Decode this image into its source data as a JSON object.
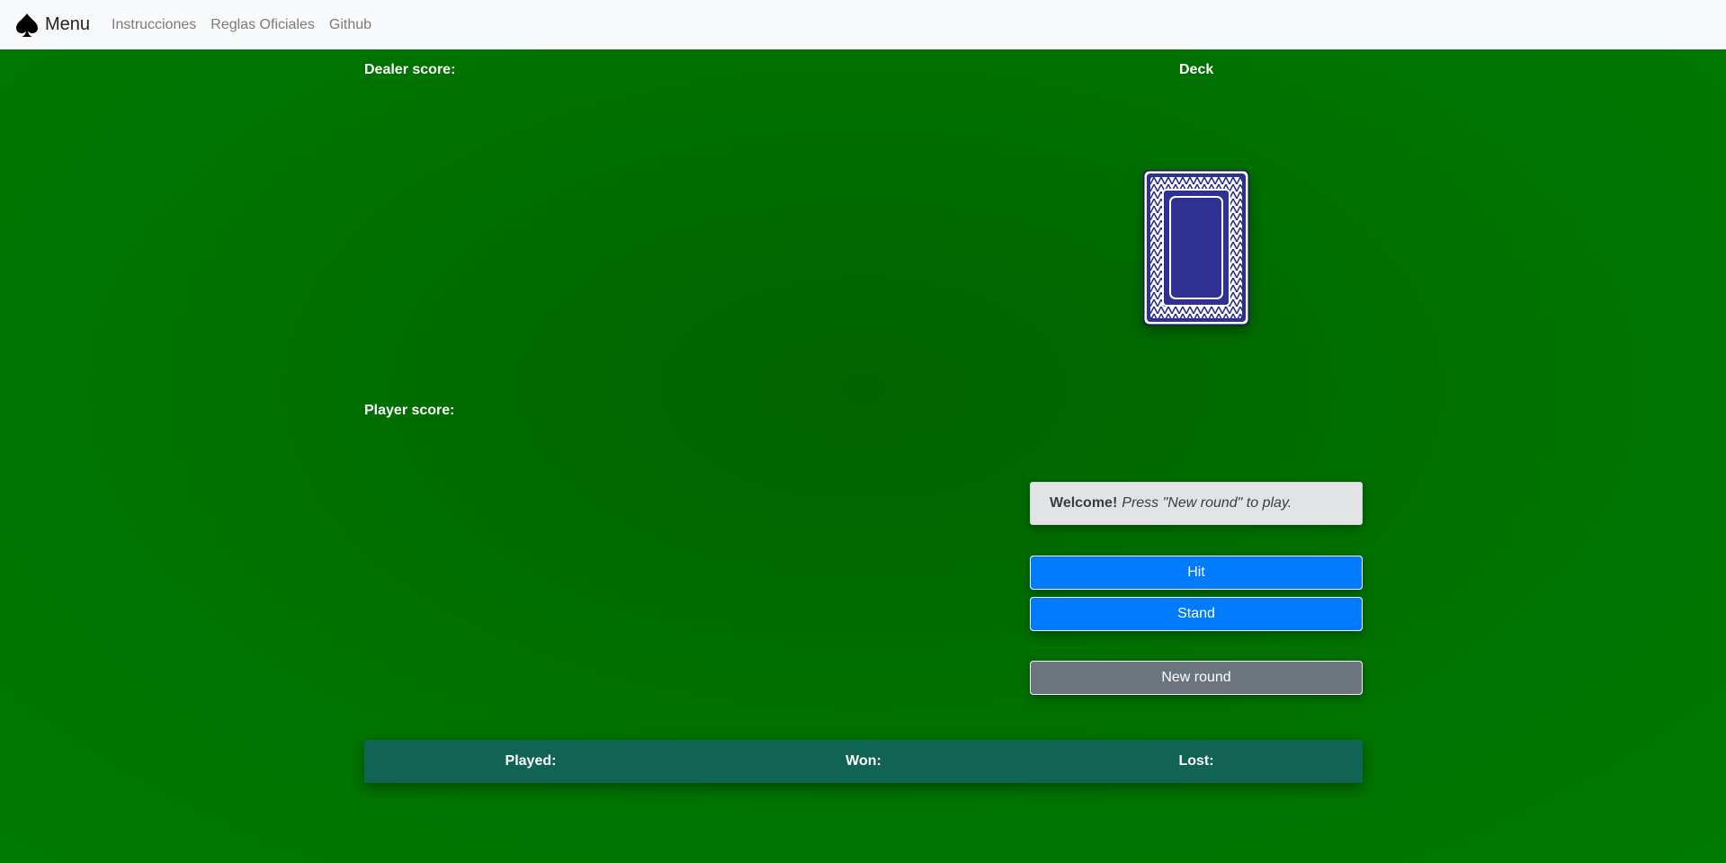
{
  "nav": {
    "brand": "Menu",
    "links": [
      "Instrucciones",
      "Reglas Oficiales",
      "Github"
    ]
  },
  "table": {
    "dealer_label": "Dealer score:",
    "deck_label": "Deck",
    "player_label": "Player score:"
  },
  "message": {
    "strong": "Welcome!",
    "text": "Press \"New round\" to play."
  },
  "buttons": {
    "hit": "Hit",
    "stand": "Stand",
    "new_round": "New round"
  },
  "stats": {
    "played": "Played:",
    "won": "Won:",
    "lost": "Lost:"
  },
  "colors": {
    "felt": "#007000",
    "primary": "#007bff",
    "secondary": "#6c757d",
    "stats_bar": "#116354",
    "card_back": "#2e3192"
  }
}
